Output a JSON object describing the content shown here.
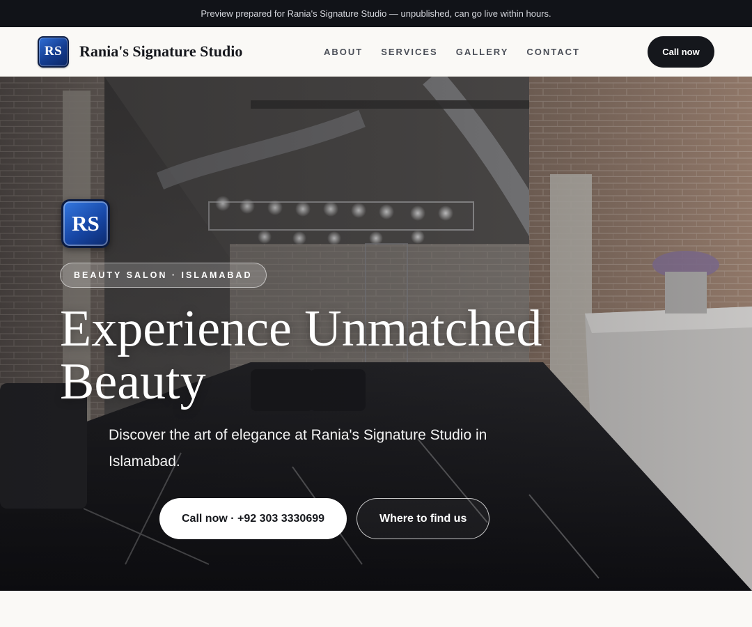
{
  "preview_banner": {
    "text": "Preview prepared for Rania's Signature Studio — unpublished, can go live within hours."
  },
  "header": {
    "logo_text": "RS",
    "brand_name": "Rania's Signature Studio",
    "nav": [
      {
        "label": "ABOUT"
      },
      {
        "label": "SERVICES"
      },
      {
        "label": "GALLERY"
      },
      {
        "label": "CONTACT"
      }
    ],
    "call_label": "Call now"
  },
  "hero": {
    "logo_text": "RS",
    "tag": "BEAUTY SALON · ISLAMABAD",
    "title": "Experience Unmatched Beauty",
    "subtitle": "Discover the art of elegance at Rania's Signature Studio in Islamabad.",
    "primary_cta": "Call now · +92 303 3330699",
    "secondary_cta": "Where to find us"
  },
  "colors": {
    "banner_bg": "#111318",
    "header_bg": "#faf9f6",
    "accent_dark": "#15171c",
    "logo_blue": "#1747a6"
  }
}
